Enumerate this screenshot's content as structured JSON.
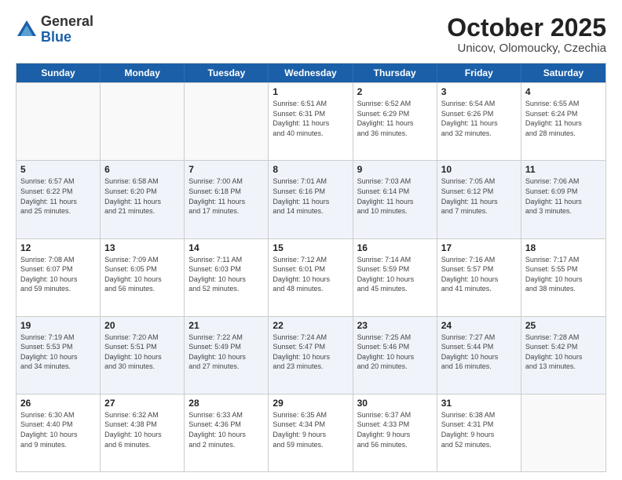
{
  "logo": {
    "general": "General",
    "blue": "Blue"
  },
  "title": "October 2025",
  "subtitle": "Unicov, Olomoucky, Czechia",
  "days": [
    "Sunday",
    "Monday",
    "Tuesday",
    "Wednesday",
    "Thursday",
    "Friday",
    "Saturday"
  ],
  "rows": [
    [
      {
        "day": "",
        "info": ""
      },
      {
        "day": "",
        "info": ""
      },
      {
        "day": "",
        "info": ""
      },
      {
        "day": "1",
        "info": "Sunrise: 6:51 AM\nSunset: 6:31 PM\nDaylight: 11 hours\nand 40 minutes."
      },
      {
        "day": "2",
        "info": "Sunrise: 6:52 AM\nSunset: 6:29 PM\nDaylight: 11 hours\nand 36 minutes."
      },
      {
        "day": "3",
        "info": "Sunrise: 6:54 AM\nSunset: 6:26 PM\nDaylight: 11 hours\nand 32 minutes."
      },
      {
        "day": "4",
        "info": "Sunrise: 6:55 AM\nSunset: 6:24 PM\nDaylight: 11 hours\nand 28 minutes."
      }
    ],
    [
      {
        "day": "5",
        "info": "Sunrise: 6:57 AM\nSunset: 6:22 PM\nDaylight: 11 hours\nand 25 minutes."
      },
      {
        "day": "6",
        "info": "Sunrise: 6:58 AM\nSunset: 6:20 PM\nDaylight: 11 hours\nand 21 minutes."
      },
      {
        "day": "7",
        "info": "Sunrise: 7:00 AM\nSunset: 6:18 PM\nDaylight: 11 hours\nand 17 minutes."
      },
      {
        "day": "8",
        "info": "Sunrise: 7:01 AM\nSunset: 6:16 PM\nDaylight: 11 hours\nand 14 minutes."
      },
      {
        "day": "9",
        "info": "Sunrise: 7:03 AM\nSunset: 6:14 PM\nDaylight: 11 hours\nand 10 minutes."
      },
      {
        "day": "10",
        "info": "Sunrise: 7:05 AM\nSunset: 6:12 PM\nDaylight: 11 hours\nand 7 minutes."
      },
      {
        "day": "11",
        "info": "Sunrise: 7:06 AM\nSunset: 6:09 PM\nDaylight: 11 hours\nand 3 minutes."
      }
    ],
    [
      {
        "day": "12",
        "info": "Sunrise: 7:08 AM\nSunset: 6:07 PM\nDaylight: 10 hours\nand 59 minutes."
      },
      {
        "day": "13",
        "info": "Sunrise: 7:09 AM\nSunset: 6:05 PM\nDaylight: 10 hours\nand 56 minutes."
      },
      {
        "day": "14",
        "info": "Sunrise: 7:11 AM\nSunset: 6:03 PM\nDaylight: 10 hours\nand 52 minutes."
      },
      {
        "day": "15",
        "info": "Sunrise: 7:12 AM\nSunset: 6:01 PM\nDaylight: 10 hours\nand 48 minutes."
      },
      {
        "day": "16",
        "info": "Sunrise: 7:14 AM\nSunset: 5:59 PM\nDaylight: 10 hours\nand 45 minutes."
      },
      {
        "day": "17",
        "info": "Sunrise: 7:16 AM\nSunset: 5:57 PM\nDaylight: 10 hours\nand 41 minutes."
      },
      {
        "day": "18",
        "info": "Sunrise: 7:17 AM\nSunset: 5:55 PM\nDaylight: 10 hours\nand 38 minutes."
      }
    ],
    [
      {
        "day": "19",
        "info": "Sunrise: 7:19 AM\nSunset: 5:53 PM\nDaylight: 10 hours\nand 34 minutes."
      },
      {
        "day": "20",
        "info": "Sunrise: 7:20 AM\nSunset: 5:51 PM\nDaylight: 10 hours\nand 30 minutes."
      },
      {
        "day": "21",
        "info": "Sunrise: 7:22 AM\nSunset: 5:49 PM\nDaylight: 10 hours\nand 27 minutes."
      },
      {
        "day": "22",
        "info": "Sunrise: 7:24 AM\nSunset: 5:47 PM\nDaylight: 10 hours\nand 23 minutes."
      },
      {
        "day": "23",
        "info": "Sunrise: 7:25 AM\nSunset: 5:46 PM\nDaylight: 10 hours\nand 20 minutes."
      },
      {
        "day": "24",
        "info": "Sunrise: 7:27 AM\nSunset: 5:44 PM\nDaylight: 10 hours\nand 16 minutes."
      },
      {
        "day": "25",
        "info": "Sunrise: 7:28 AM\nSunset: 5:42 PM\nDaylight: 10 hours\nand 13 minutes."
      }
    ],
    [
      {
        "day": "26",
        "info": "Sunrise: 6:30 AM\nSunset: 4:40 PM\nDaylight: 10 hours\nand 9 minutes."
      },
      {
        "day": "27",
        "info": "Sunrise: 6:32 AM\nSunset: 4:38 PM\nDaylight: 10 hours\nand 6 minutes."
      },
      {
        "day": "28",
        "info": "Sunrise: 6:33 AM\nSunset: 4:36 PM\nDaylight: 10 hours\nand 2 minutes."
      },
      {
        "day": "29",
        "info": "Sunrise: 6:35 AM\nSunset: 4:34 PM\nDaylight: 9 hours\nand 59 minutes."
      },
      {
        "day": "30",
        "info": "Sunrise: 6:37 AM\nSunset: 4:33 PM\nDaylight: 9 hours\nand 56 minutes."
      },
      {
        "day": "31",
        "info": "Sunrise: 6:38 AM\nSunset: 4:31 PM\nDaylight: 9 hours\nand 52 minutes."
      },
      {
        "day": "",
        "info": ""
      }
    ]
  ]
}
